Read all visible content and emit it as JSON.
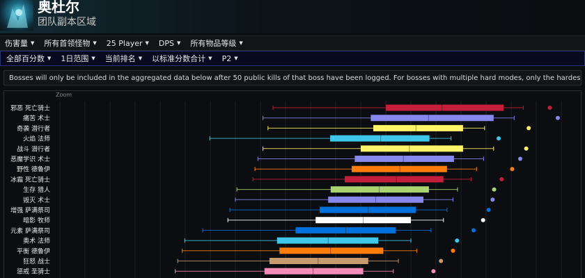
{
  "header": {
    "zone_title": "奥杜尔",
    "zone_subtitle": "团队副本区域",
    "art_icon": "boss-portrait-icon"
  },
  "filters_row1": [
    {
      "label": "伤害量"
    },
    {
      "label": "所有首领怪物"
    },
    {
      "label": "25 Player"
    },
    {
      "label": "DPS"
    },
    {
      "label": "所有物品等级"
    }
  ],
  "filters_row2": [
    {
      "label": "全部百分数"
    },
    {
      "label": "1日范围"
    },
    {
      "label": "当前排名"
    },
    {
      "label": "以标准分数合计"
    },
    {
      "label": "P2"
    }
  ],
  "notice": "Bosses will only be included in the aggregated data below after 50 public kills of that boss have been logged. For bosses with multiple hard modes, only the hardest mode is supported.",
  "chart_data": {
    "type": "box",
    "zoom_label": "Zoom",
    "x_domain": [
      0,
      100
    ],
    "grid": true,
    "rows": [
      {
        "label": "邪恶 死亡骑士",
        "color": "#C41E3A",
        "whisker_low": 42.5,
        "q1": 65.0,
        "median": 76.2,
        "q3": 88.5,
        "whisker_high": 92.4,
        "outlier": 97.7
      },
      {
        "label": "痛苦 术士",
        "color": "#8787ED",
        "whisker_low": 40.5,
        "q1": 62.0,
        "median": 73.5,
        "q3": 86.5,
        "whisker_high": 90.6,
        "outlier": 99.3
      },
      {
        "label": "奇袭 潜行者",
        "color": "#FFF468",
        "whisker_low": 41.5,
        "q1": 62.5,
        "median": 71.0,
        "q3": 80.4,
        "whisker_high": 84.7,
        "outlier": 93.5
      },
      {
        "label": "火焰 法师",
        "color": "#3FC7EB",
        "whisker_low": 29.9,
        "q1": 53.9,
        "median": 64.0,
        "q3": 73.7,
        "whisker_high": 78.0,
        "outlier": 87.5
      },
      {
        "label": "战斗 潜行者",
        "color": "#FFF468",
        "whisker_low": 40.5,
        "q1": 60.0,
        "median": 69.7,
        "q3": 80.4,
        "whisker_high": 86.5,
        "outlier": 93.0
      },
      {
        "label": "恶魔学识 术士",
        "color": "#8787ED",
        "whisker_low": 39.5,
        "q1": 58.8,
        "median": 68.5,
        "q3": 78.6,
        "whisker_high": 84.5,
        "outlier": 91.8
      },
      {
        "label": "野性 德鲁伊",
        "color": "#FF7C0A",
        "whisker_low": 38.9,
        "q1": 58.2,
        "median": 67.8,
        "q3": 77.2,
        "whisker_high": 83.1,
        "outlier": 90.2
      },
      {
        "label": "冰霜 死亡骑士",
        "color": "#C41E3A",
        "whisker_low": 38.5,
        "q1": 56.8,
        "median": 67.1,
        "q3": 76.5,
        "whisker_high": 82.0,
        "outlier": 88.1
      },
      {
        "label": "生存 猎人",
        "color": "#AAD372",
        "whisker_low": 35.3,
        "q1": 54.0,
        "median": 63.7,
        "q3": 73.6,
        "whisker_high": 79.3,
        "outlier": 86.6
      },
      {
        "label": "毁灭 术士",
        "color": "#8787ED",
        "whisker_low": 35.0,
        "q1": 53.5,
        "median": 63.0,
        "q3": 72.5,
        "whisker_high": 78.4,
        "outlier": 86.3
      },
      {
        "label": "增强 萨满祭司",
        "color": "#0070DD",
        "whisker_low": 33.9,
        "q1": 51.8,
        "median": 61.5,
        "q3": 71.0,
        "whisker_high": 77.2,
        "outlier": 85.5
      },
      {
        "label": "暗影 牧师",
        "color": "#FFFFFF",
        "whisker_low": 33.5,
        "q1": 51.0,
        "median": 60.5,
        "q3": 70.0,
        "whisker_high": 76.5,
        "outlier": 84.4
      },
      {
        "label": "元素 萨满祭司",
        "color": "#0070DD",
        "whisker_low": 28.5,
        "q1": 47.0,
        "median": 57.0,
        "q3": 67.0,
        "whisker_high": 74.0,
        "outlier": 82.5
      },
      {
        "label": "奥术 法师",
        "color": "#3FC7EB",
        "whisker_low": 24.9,
        "q1": 43.3,
        "median": 53.5,
        "q3": 63.5,
        "whisker_high": 70.0,
        "outlier": 79.2
      },
      {
        "label": "平衡 德鲁伊",
        "color": "#FF7C0A",
        "whisker_low": 24.4,
        "q1": 43.8,
        "median": 54.0,
        "q3": 64.5,
        "whisker_high": 71.2,
        "outlier": 78.4
      },
      {
        "label": "狂怒 战士",
        "color": "#C69B6D",
        "whisker_low": 23.5,
        "q1": 41.8,
        "median": 51.5,
        "q3": 61.5,
        "whisker_high": 67.5,
        "outlier": 76.0
      },
      {
        "label": "惩戒 圣骑士",
        "color": "#F48CBA",
        "whisker_low": 23.0,
        "q1": 40.8,
        "median": 50.5,
        "q3": 60.5,
        "whisker_high": 66.5,
        "outlier": 74.5
      }
    ]
  }
}
